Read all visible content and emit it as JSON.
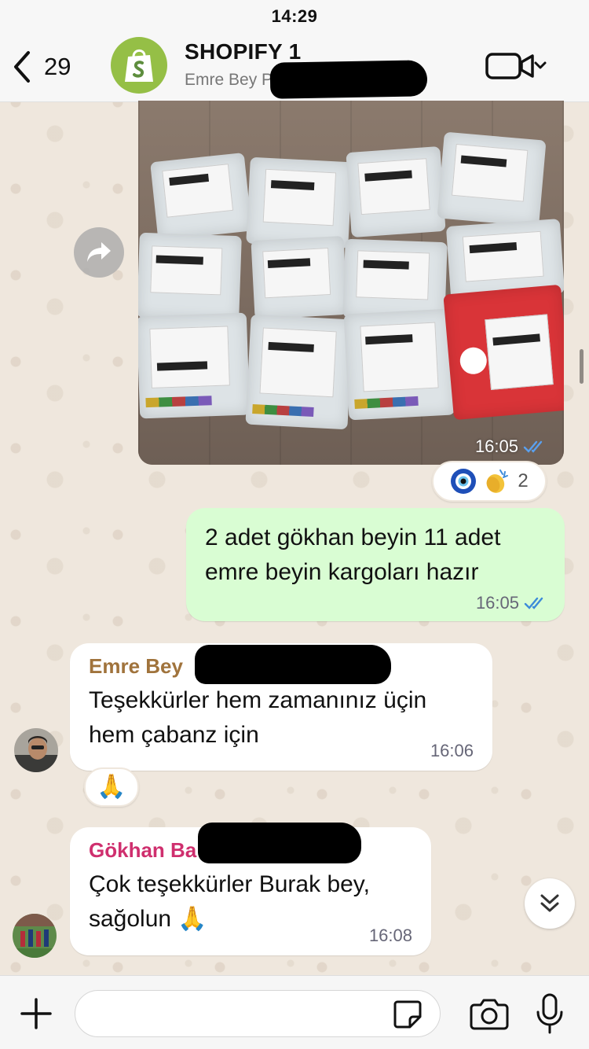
{
  "status_bar": {
    "time": "14:29"
  },
  "header": {
    "back_count": "29",
    "title": "SHOPIFY 1",
    "subtitle": "Emre Bey P                    E…"
  },
  "messages": {
    "image_message": {
      "time": "16:05",
      "status": "read"
    },
    "image_reactions": {
      "emojis": [
        "nazar-amulet",
        "clapping-hands"
      ],
      "count": "2"
    },
    "outgoing": {
      "text": "2 adet gökhan beyin 11 adet emre beyin kargoları hazır",
      "time": "16:05"
    },
    "incoming_1": {
      "sender": "Emre Bey",
      "text": "Teşekkürler hem zamanınız üçin hem çabanz için",
      "time": "16:06",
      "reaction": "🙏"
    },
    "incoming_2": {
      "sender": "Gökhan Ba",
      "text": "Çok teşekkürler Burak bey, sağolun 🙏",
      "time": "16:08"
    }
  },
  "colors": {
    "sender_1": "#a0733c",
    "sender_2": "#cf2f6e",
    "read_tick": "#3d8bd9",
    "outgoing_bubble": "#d9fdd3",
    "shopify_green": "#95bf46"
  },
  "composer": {
    "placeholder": ""
  }
}
